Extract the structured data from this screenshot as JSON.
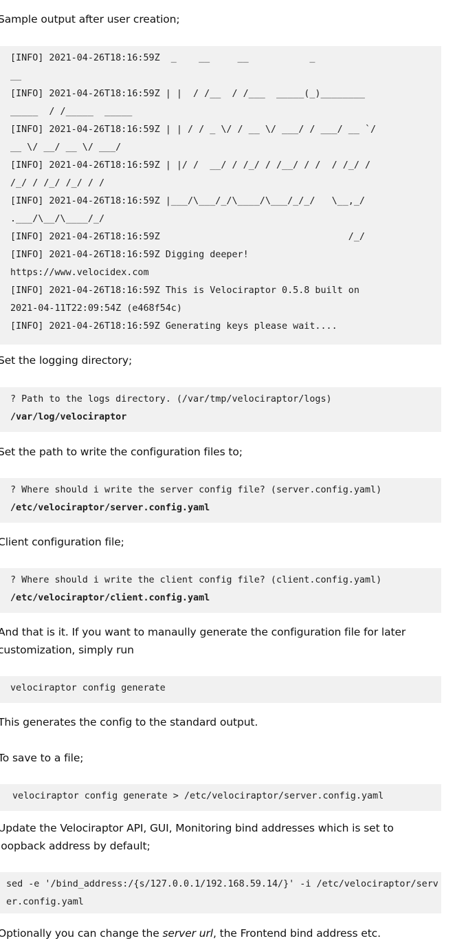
{
  "intro": "Sample output after user creation;",
  "log_lines": [
    "[INFO] 2021-04-26T18:16:59Z  _    __     __           _",
    "__",
    "[INFO] 2021-04-26T18:16:59Z | |  / /__  / /___  _____(_)________",
    "_____  / /_____  _____",
    "[INFO] 2021-04-26T18:16:59Z | | / / _ \\/ / __ \\/ ___/ / ___/ __ `/",
    "__ \\/ __/ __ \\/ ___/",
    "[INFO] 2021-04-26T18:16:59Z | |/ /  __/ / /_/ / /__/ / /  / /_/ /",
    "/_/ / /_/ /_/ / /",
    "[INFO] 2021-04-26T18:16:59Z |___/\\___/_/\\____/\\___/_/_/   \\__,_/",
    ".___/\\__/\\____/_/",
    "[INFO] 2021-04-26T18:16:59Z                                  /_/",
    "[INFO] 2021-04-26T18:16:59Z Digging deeper!",
    "https://www.velocidex.com",
    "[INFO] 2021-04-26T18:16:59Z This is Velociraptor 0.5.8 built on",
    "2021-04-11T22:09:54Z (e468f54c)",
    "[INFO] 2021-04-26T18:16:59Z Generating keys please wait...."
  ],
  "logging_text": "Set the logging directory;",
  "logging_prompt": "? Path to the logs directory. (/var/tmp/velociraptor/logs)",
  "logging_answer": "/var/log/velociraptor",
  "config_path_text": "Set the path to write the configuration files to;",
  "server_prompt": "? Where should i write the server config file? (server.config.yaml)",
  "server_answer": "/etc/velociraptor/server.config.yaml",
  "client_text": "Client configuration file;",
  "client_prompt": "? Where should i write the client config file? (client.config.yaml)",
  "client_answer": "/etc/velociraptor/client.config.yaml",
  "manual_text": "And that is it. If you want to manaully generate the configuration file for later customization, simply run",
  "generate_cmd": "velociraptor config generate",
  "stdout_text": "This generates the config to the standard output.",
  "save_text": "To save to a file;",
  "save_cmd": "velociraptor config generate > /etc/velociraptor/server.config.yaml",
  "bind_text": "Update the Velociraptor API, GUI, Monitoring bind addresses which is set to loopback address by default;",
  "sed_cmd": "sed -e '/bind_address:/{s/127.0.0.1/192.168.59.14/}' -i /etc/velociraptor/server.config.yaml",
  "optional": {
    "before": "Optionally you can change the ",
    "emphasis": "server url",
    "after": ", the Frontend bind address etc."
  }
}
